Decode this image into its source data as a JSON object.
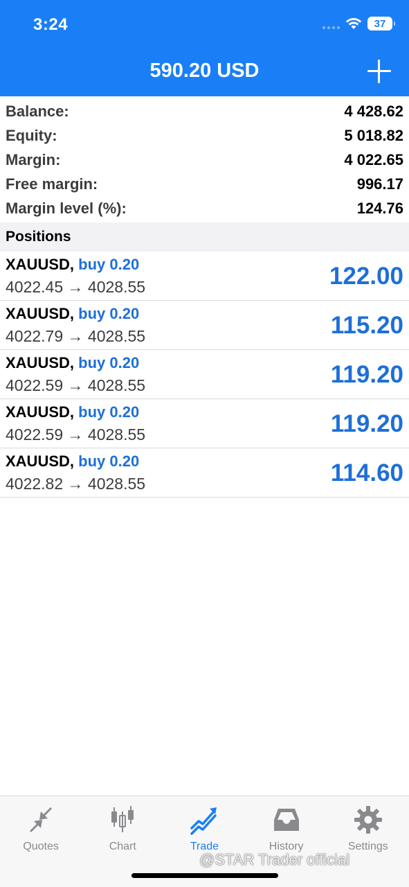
{
  "status_bar": {
    "time": "3:24",
    "battery": "37"
  },
  "header": {
    "title": "590.20 USD"
  },
  "summary": [
    {
      "label": "Balance:",
      "value": "4 428.62"
    },
    {
      "label": "Equity:",
      "value": "5 018.82"
    },
    {
      "label": "Margin:",
      "value": "4 022.65"
    },
    {
      "label": "Free margin:",
      "value": "996.17"
    },
    {
      "label": "Margin level (%):",
      "value": "124.76"
    }
  ],
  "positions_header": "Positions",
  "positions": [
    {
      "symbol": "XAUUSD,",
      "side": "buy 0.20",
      "open_price": "4022.45",
      "arrow": "→",
      "current_price": "4028.55",
      "profit": "122.00"
    },
    {
      "symbol": "XAUUSD,",
      "side": "buy 0.20",
      "open_price": "4022.79",
      "arrow": "→",
      "current_price": "4028.55",
      "profit": "115.20"
    },
    {
      "symbol": "XAUUSD,",
      "side": "buy 0.20",
      "open_price": "4022.59",
      "arrow": "→",
      "current_price": "4028.55",
      "profit": "119.20"
    },
    {
      "symbol": "XAUUSD,",
      "side": "buy 0.20",
      "open_price": "4022.59",
      "arrow": "→",
      "current_price": "4028.55",
      "profit": "119.20"
    },
    {
      "symbol": "XAUUSD,",
      "side": "buy 0.20",
      "open_price": "4022.82",
      "arrow": "→",
      "current_price": "4028.55",
      "profit": "114.60"
    }
  ],
  "tabs": [
    {
      "label": "Quotes",
      "icon": "quotes-icon",
      "active": false
    },
    {
      "label": "Chart",
      "icon": "candlestick-chart-icon",
      "active": false
    },
    {
      "label": "Trade",
      "icon": "trade-trend-icon",
      "active": true
    },
    {
      "label": "History",
      "icon": "inbox-history-icon",
      "active": false
    },
    {
      "label": "Settings",
      "icon": "gear-icon",
      "active": false
    }
  ],
  "watermark": "@STAR Trader official",
  "colors": {
    "accent": "#1a7ff6",
    "profit": "#1d6fd9",
    "inactive_tab": "#8a8a8e"
  }
}
